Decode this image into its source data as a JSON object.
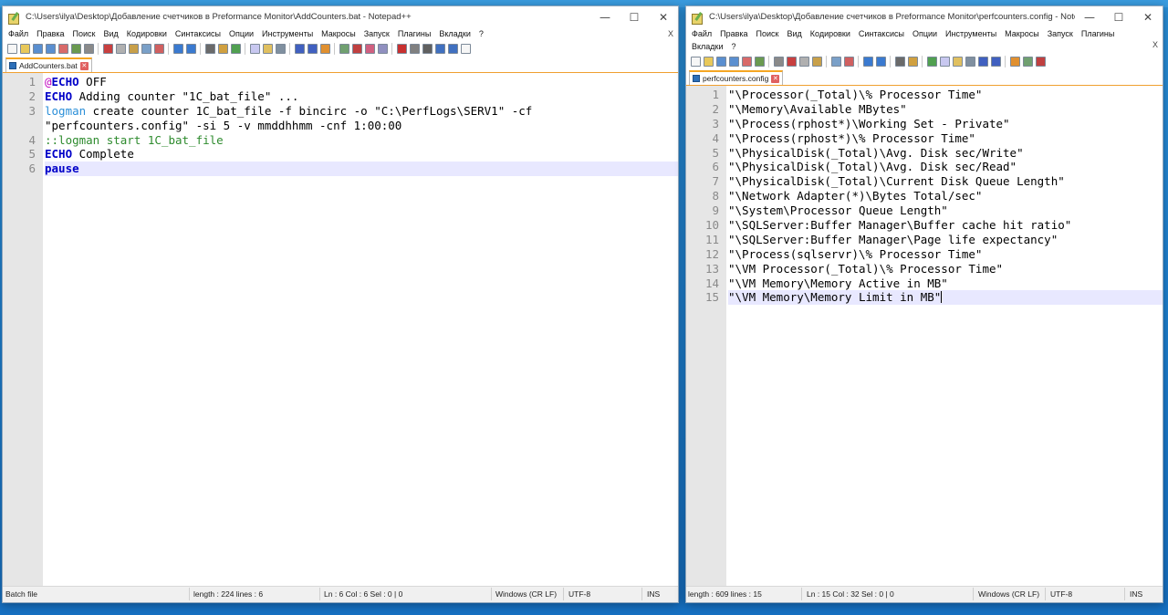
{
  "left": {
    "title": "C:\\Users\\ilya\\Desktop\\Добавление счетчиков в Preformance Monitor\\AddCounters.bat - Notepad++",
    "menu": [
      "Файл",
      "Правка",
      "Поиск",
      "Вид",
      "Кодировки",
      "Синтаксисы",
      "Опции",
      "Инструменты",
      "Макросы",
      "Запуск",
      "Плагины",
      "Вкладки",
      "?"
    ],
    "menu_close": "X",
    "tab": "AddCounters.bat",
    "lines": [
      [
        {
          "t": "@",
          "c": "at"
        },
        {
          "t": "ECHO",
          "c": "kw"
        },
        {
          "t": " OFF",
          "c": ""
        }
      ],
      [
        {
          "t": "ECHO",
          "c": "kw"
        },
        {
          "t": " Adding counter \"1C_bat_file\" ...",
          "c": ""
        }
      ],
      [
        {
          "t": "logman",
          "c": "cmd"
        },
        {
          "t": " create counter 1C_bat_file -f bincirc -o \"C:\\PerfLogs\\SERV1\" -cf",
          "c": ""
        }
      ],
      [
        {
          "t": "\"perfcounters.config\" -si 5 -v mmddhhmm -cnf 1:00:00",
          "c": ""
        }
      ],
      [
        {
          "t": "::logman start 1C_bat_file",
          "c": "cmt"
        }
      ],
      [
        {
          "t": "ECHO",
          "c": "kw"
        },
        {
          "t": " Complete",
          "c": ""
        }
      ],
      [
        {
          "t": "pause",
          "c": "kw"
        }
      ]
    ],
    "line_numbers": [
      "1",
      "2",
      "3",
      "",
      "4",
      "5",
      "6"
    ],
    "status": {
      "type": "Batch file",
      "length": "length : 224    lines : 6",
      "pos": "Ln : 6    Col : 6    Sel : 0 | 0",
      "eol": "Windows (CR LF)",
      "enc": "UTF-8",
      "ins": "INS"
    }
  },
  "right": {
    "title": "C:\\Users\\ilya\\Desktop\\Добавление счетчиков в Preformance Monitor\\perfcounters.config - Notepad...",
    "menu": [
      "Файл",
      "Правка",
      "Поиск",
      "Вид",
      "Кодировки",
      "Синтаксисы",
      "Опции",
      "Инструменты",
      "Макросы",
      "Запуск",
      "Плагины",
      "Вкладки",
      "?"
    ],
    "menu_close": "X",
    "tab": "perfcounters.config",
    "lines": [
      "\"\\Processor(_Total)\\% Processor Time\"",
      "\"\\Memory\\Available MBytes\"",
      "\"\\Process(rphost*)\\Working Set - Private\"",
      "\"\\Process(rphost*)\\% Processor Time\"",
      "\"\\PhysicalDisk(_Total)\\Avg. Disk sec/Write\"",
      "\"\\PhysicalDisk(_Total)\\Avg. Disk sec/Read\"",
      "\"\\PhysicalDisk(_Total)\\Current Disk Queue Length\"",
      "\"\\Network Adapter(*)\\Bytes Total/sec\"",
      "\"\\System\\Processor Queue Length\"",
      "\"\\SQLServer:Buffer Manager\\Buffer cache hit ratio\"",
      "\"\\SQLServer:Buffer Manager\\Page life expectancy\"",
      "\"\\Process(sqlservr)\\% Processor Time\"",
      "\"\\VM Processor(_Total)\\% Processor Time\"",
      "\"\\VM Memory\\Memory Active in MB\"",
      "\"\\VM Memory\\Memory Limit in MB\""
    ],
    "status": {
      "length": "length : 609    lines : 15",
      "pos": "Ln : 15    Col : 32    Sel : 0 | 0",
      "eol": "Windows (CR LF)",
      "enc": "UTF-8",
      "ins": "INS"
    }
  },
  "window_controls": {
    "min": "—",
    "max": "☐",
    "close": "✕"
  }
}
